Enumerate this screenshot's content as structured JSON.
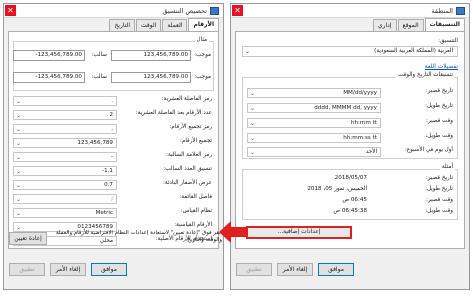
{
  "left_dialog": {
    "title": "تخصيص التنسيق",
    "tabs": [
      "الأرقام",
      "العملة",
      "الوقت",
      "التاريخ"
    ],
    "example_legend": "مثال",
    "positive_label": "موجب:",
    "negative_label": "سالب:",
    "positive_values": [
      "123,456,789.00",
      "123,456,789.00"
    ],
    "negative_values": [
      "-123,456,789.00",
      "-123,456,789.00"
    ],
    "settings": [
      {
        "label": "رمز الفاصلة العشرية:",
        "value": "."
      },
      {
        "label": "عدد الأرقام بعد الفاصلة العشرية:",
        "value": "2"
      },
      {
        "label": "رمز تجميع الأرقام:",
        "value": ","
      },
      {
        "label": "تجميع الأرقام:",
        "value": "123,456,789"
      },
      {
        "label": "رمز العلامة السالبة:",
        "value": "-"
      },
      {
        "label": "تنسيق العدد السالب:",
        "value": "-1.1"
      },
      {
        "label": "عرض الأصفار البادئة:",
        "value": "0.7"
      },
      {
        "label": "فاصل القائمة:",
        "value": ";"
      },
      {
        "label": "نظام القياس:",
        "value": "Metric"
      },
      {
        "label": "الأرقام القياسية:",
        "value": "0123456789"
      },
      {
        "label": "استخدام الأرقام الأصلية:",
        "value": "محلي"
      }
    ],
    "reset_note": "انقر فوق \"إعادة تعيين\" لاستعادة إعدادات النظام الافتراضية للأرقام والعملة والوقت والتاريخ.",
    "reset_button": "إعادة تعيين",
    "buttons": {
      "ok": "موافق",
      "cancel": "إلغاء الأمر",
      "apply": "تطبيق"
    }
  },
  "right_dialog": {
    "title": "المنطقة",
    "tabs": [
      "التنسيقات",
      "الموقع",
      "إداري"
    ],
    "format_label": "التنسيق:",
    "format_value": "العربية (المملكة العربية السعودية)",
    "language_prefs_link": "تفضيلات اللغة",
    "date_time_header": "تنسيقات التاريخ والوقت",
    "fields": [
      {
        "label": "تاريخ قصير:",
        "value": "MM/dd/yyyy"
      },
      {
        "label": "تاريخ طويل:",
        "value": "dddd, MMMM dd, yyyy"
      },
      {
        "label": "وقت قصير:",
        "value": "hh:mm tt"
      },
      {
        "label": "وقت طويل:",
        "value": "hh:mm:ss tt"
      },
      {
        "label": "أول يوم في الأسبوع:",
        "value": "الأحد"
      }
    ],
    "examples_legend": "أمثلة",
    "examples": [
      {
        "label": "تاريخ قصير:",
        "value": "2018/05/07"
      },
      {
        "label": "تاريخ طويل:",
        "value": "الخميس، تموز 05، 2018"
      },
      {
        "label": "وقت قصير:",
        "value": "06:45 ص"
      },
      {
        "label": "وقت طويل:",
        "value": "06:45:38 ص"
      }
    ],
    "additional_settings_button": "إعدادات إضافية...",
    "buttons": {
      "ok": "موافق",
      "cancel": "إلغاء الأمر",
      "apply": "تطبيق"
    }
  },
  "colors": {
    "accent": "#0078d7",
    "highlight": "#e02020",
    "close": "#e81123"
  }
}
